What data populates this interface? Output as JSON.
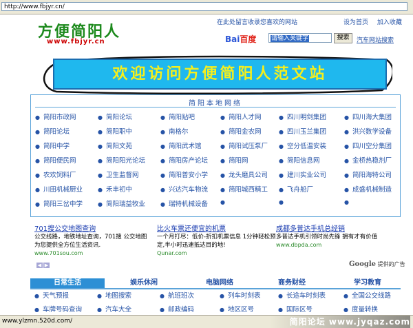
{
  "browser": {
    "url": "http://www.fbjyr.cn/",
    "status_url": "www.ylzmn.520d.com/"
  },
  "header": {
    "logo": "方便简阳人",
    "logo_url": "www.fbjyr.cn",
    "message": "在此处留言收录您喜欢的网站",
    "links": [
      "设为首页",
      "加入收藏"
    ]
  },
  "search": {
    "brand_bai": "Bai",
    "brand_du": "百度",
    "input_value": "请输入关键字",
    "button_label": "搜索",
    "extra_link": "汽车网站搜索"
  },
  "banner": {
    "text": "欢迎访问方便简阳人范文站"
  },
  "local": {
    "title": "简阳本地网络",
    "rows": [
      [
        "简阳市政网",
        "简阳论坛",
        "简阳贴吧",
        "简阳人才网",
        "四川明剑集团",
        "四川海大集团"
      ],
      [
        "简阳论坛",
        "简阳职中",
        "南格尔",
        "简阳金农网",
        "四川玉兰集团",
        "洪兴数学设备"
      ],
      [
        "简阳中学",
        "简阳文苑",
        "简阳武术馆",
        "简阳试压泵厂",
        "空分低温安装",
        "四川空分集团"
      ],
      [
        "简阳便民网",
        "简阳阳光论坛",
        "简阳房产论坛",
        "简阳网",
        "简阳信息网",
        "金桥热稳剂厂"
      ],
      [
        "农欢饲料厂",
        "卫生监督网",
        "简阳普安小学",
        "龙头磨具公司",
        "建川实业公司",
        "简阳海特公司"
      ],
      [
        "川田机械厨业",
        "禾丰初中",
        "兴达汽车物流",
        "简阳城西精工",
        "飞舟船厂",
        "成盛机械制造"
      ],
      [
        "简阳三岔中学",
        "简阳瑞益牧业",
        "瑞特机械设备",
        "",
        "",
        ""
      ]
    ],
    "highlight": "简阳信息网"
  },
  "ads": [
    {
      "title": "701搜公交地图查询",
      "desc1": "公交线路，地铁地址查询，701搜 公交地图",
      "desc2": "为您提供全方位生活资讯.",
      "url": "www.701sou.com"
    },
    {
      "title": "比火车票还便宜的机票",
      "desc1": "一个月打尽：低价-折扣机票信息 1分钟轻松预",
      "desc2": "定,半小时迅速抵达目的地!",
      "url": "Qunar.com"
    },
    {
      "title": "成都多普达手机总经销",
      "desc1": "多普达手机引领时尚先锋 拥有才有价值",
      "desc2": "",
      "url": "www.dbpda.com"
    }
  ],
  "google": {
    "brand": "Google",
    "label": "提供的广告"
  },
  "tabs": [
    "日常生活",
    "娱乐休闲",
    "电脑网络",
    "商务财经",
    "学习教育"
  ],
  "daily": {
    "rows": [
      [
        "天气预报",
        "地图搜索",
        "航班班次",
        "列车时刻表",
        "长途车时刻表",
        "全国公交线路"
      ],
      [
        "车牌号码查询",
        "汽车大全",
        "邮政编码",
        "地区区号",
        "国际区号",
        "度量转换"
      ]
    ]
  },
  "watermark": "简阳论坛 www.jyqaz.com"
}
